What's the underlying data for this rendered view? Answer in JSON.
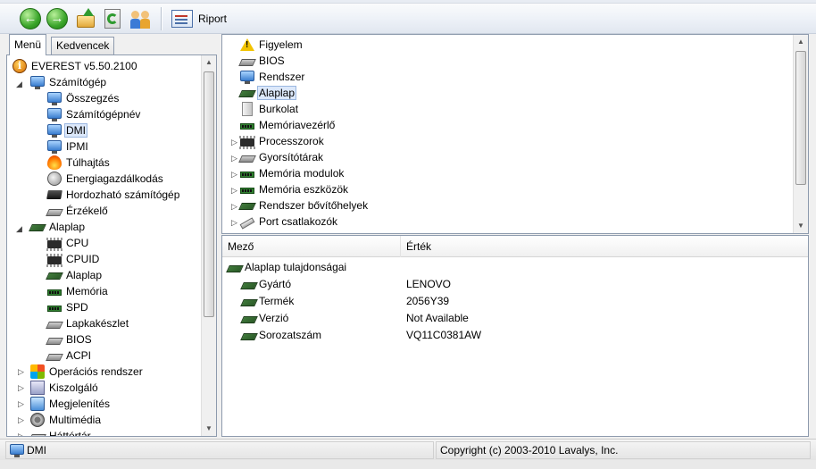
{
  "toolbar": {
    "report_label": "Riport"
  },
  "left_tabs": [
    "Menü",
    "Kedvencek"
  ],
  "tree": {
    "root": "EVEREST v5.50.2100",
    "group1": "Számítógép",
    "group1_items": [
      "Összegzés",
      "Számítógépnév",
      "DMI",
      "IPMI",
      "Túlhajtás",
      "Energiagazdálkodás",
      "Hordozható számítógép",
      "Érzékelő"
    ],
    "group2": "Alaplap",
    "group2_items": [
      "CPU",
      "CPUID",
      "Alaplap",
      "Memória",
      "SPD",
      "Lapkakészlet",
      "BIOS",
      "ACPI"
    ],
    "collapsed": [
      "Operációs rendszer",
      "Kiszolgáló",
      "Megjelenítés",
      "Multimédia",
      "Háttértár"
    ],
    "selected": "DMI"
  },
  "categories": {
    "items": [
      "Figyelem",
      "BIOS",
      "Rendszer",
      "Alaplap",
      "Burkolat",
      "Memóriavezérlő",
      "Processzorok",
      "Gyorsítótárak",
      "Memória modulok",
      "Memória eszközök",
      "Rendszer bővítőhelyek",
      "Port csatlakozók"
    ],
    "selected": "Alaplap"
  },
  "details": {
    "col_field": "Mező",
    "col_value": "Érték",
    "group": "Alaplap tulajdonságai",
    "rows": [
      {
        "field": "Gyártó",
        "value": "LENOVO"
      },
      {
        "field": "Termék",
        "value": "2056Y39"
      },
      {
        "field": "Verzió",
        "value": "Not Available"
      },
      {
        "field": "Sorozatszám",
        "value": "VQ11C0381AW"
      }
    ]
  },
  "status": {
    "left": "DMI",
    "right": "Copyright (c) 2003-2010 Lavalys, Inc."
  }
}
